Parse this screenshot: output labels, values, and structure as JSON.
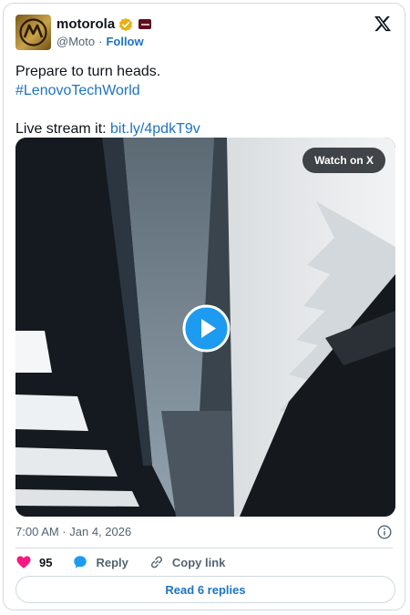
{
  "account": {
    "name": "motorola",
    "handle": "@Moto",
    "separator": "·",
    "follow_label": "Follow",
    "avatar_icon": "motorola-logo-icon",
    "verified_icon": "gold-verified-badge-icon",
    "affiliate_icon": "lenovo-affiliate-badge-icon"
  },
  "tweet": {
    "lines": [
      "Prepare to turn heads."
    ],
    "hashtag": "#LenovoTechWorld",
    "live_prefix": "Live stream it: ",
    "live_link": "bit.ly/4pdkT9v"
  },
  "media": {
    "watch_label": "Watch on X",
    "play_icon": "play-icon"
  },
  "meta": {
    "timestamp": "7:00 AM · Jan 4, 2026"
  },
  "actions": {
    "like_count": "95",
    "reply_label": "Reply",
    "copy_label": "Copy link"
  },
  "read_replies_label": "Read 6 replies",
  "colors": {
    "link": "#1d73c5",
    "like": "#f91880",
    "border": "#cfd9de",
    "muted": "#536471"
  }
}
